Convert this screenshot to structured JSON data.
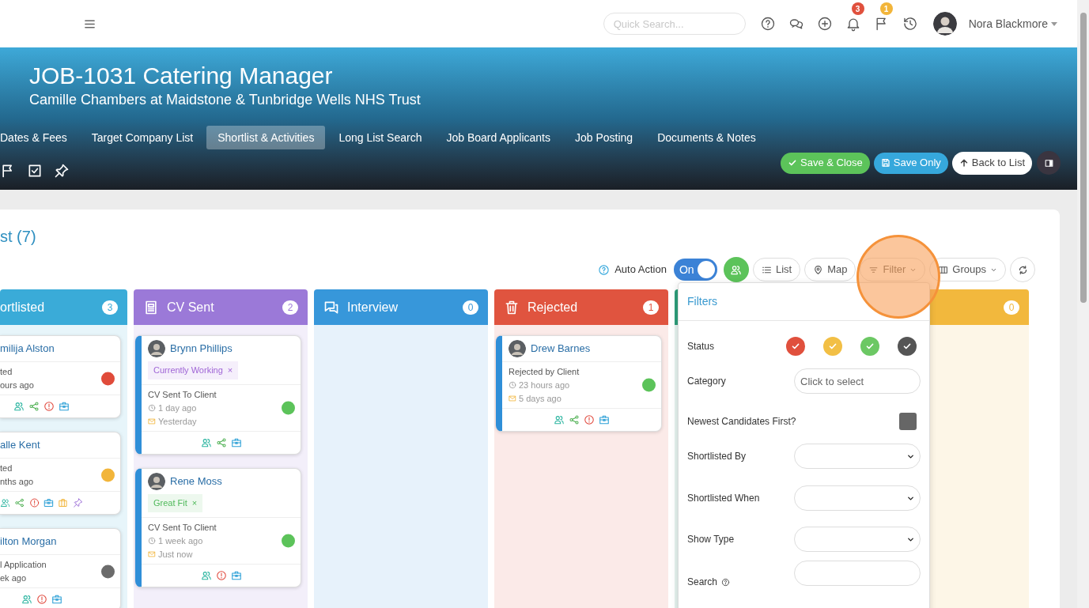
{
  "topbar": {
    "search_placeholder": "Quick Search...",
    "icons": [
      {
        "kind": "help"
      },
      {
        "kind": "chat"
      },
      {
        "kind": "add"
      },
      {
        "kind": "bell",
        "badge": "3",
        "color": "#e0503d"
      },
      {
        "kind": "flag",
        "badge": "1",
        "color": "#f2b53a"
      },
      {
        "kind": "history"
      }
    ],
    "user": {
      "name": "Nora Blackmore"
    }
  },
  "header": {
    "title": "JOB-1031 Catering Manager",
    "subtitle": "Camille Chambers at Maidstone & Tunbridge Wells NHS Trust",
    "tabs": [
      {
        "label": "Dates & Fees",
        "selected": false
      },
      {
        "label": "Target Company List",
        "selected": false
      },
      {
        "label": "Shortlist & Activities",
        "selected": true
      },
      {
        "label": "Long List Search",
        "selected": false
      },
      {
        "label": "Job Board Applicants",
        "selected": false
      },
      {
        "label": "Job Posting",
        "selected": false
      },
      {
        "label": "Documents & Notes",
        "selected": false
      }
    ],
    "quick_icons": [
      {
        "kind": "flag"
      },
      {
        "kind": "check-square"
      },
      {
        "kind": "pin"
      }
    ],
    "buttons": [
      {
        "kind": "save-close",
        "label": "Save & Close"
      },
      {
        "kind": "save",
        "label": "Save Only"
      },
      {
        "kind": "back",
        "label": "Back to List"
      },
      {
        "kind": "sidebar"
      }
    ]
  },
  "board": {
    "title": "st (7)",
    "auto_action": {
      "label": "Auto Action",
      "toggle": {
        "on": true,
        "label": "On"
      }
    },
    "tools": [
      {
        "kind": "people"
      },
      {
        "kind": "list",
        "label": "List"
      },
      {
        "kind": "map",
        "label": "Map"
      },
      {
        "kind": "filter",
        "label": "Filter"
      },
      {
        "kind": "groups",
        "label": "Groups"
      },
      {
        "kind": "refresh"
      }
    ],
    "columns": [
      {
        "kind": "plain",
        "title": "ortlisted",
        "count": "3",
        "color": "#3aabd8",
        "cards": [
          {
            "name": "milija Alston",
            "avatar": false,
            "stripe": false,
            "lines": [
              {
                "text": "ted"
              },
              {
                "text": "ours ago"
              }
            ],
            "color": "#e04b3a",
            "icons": [
              {
                "kind": "people"
              },
              {
                "kind": "share"
              },
              {
                "kind": "alert"
              },
              {
                "kind": "briefcase"
              }
            ]
          },
          {
            "name": "alle Kent",
            "avatar": false,
            "stripe": false,
            "lines": [
              {
                "text": "ted"
              },
              {
                "text": "nths ago"
              }
            ],
            "color": "#f2b53a",
            "icons": [
              {
                "kind": "people"
              },
              {
                "kind": "share"
              },
              {
                "kind": "alert"
              },
              {
                "kind": "briefcase"
              },
              {
                "kind": "suitcase"
              },
              {
                "kind": "pin"
              }
            ]
          },
          {
            "name": "ilton Morgan",
            "avatar": false,
            "stripe": false,
            "lines": [
              {
                "text": "l Application"
              },
              {
                "text": "ek ago"
              }
            ],
            "color": "#6b6b6b",
            "icons": [
              {
                "kind": "people"
              },
              {
                "kind": "alert"
              },
              {
                "kind": "briefcase"
              }
            ]
          }
        ]
      },
      {
        "kind": "cv",
        "title": "CV Sent",
        "count": "2",
        "color": "#9b79d8",
        "cards": [
          {
            "name": "Brynn Phillips",
            "avatar": true,
            "stripe": true,
            "tag": {
              "text": "Currently Working",
              "remove": "×",
              "color": "#a066d6"
            },
            "lines": [
              {
                "text": "CV Sent To Client",
                "kind": "status"
              },
              {
                "text": "1 day ago",
                "kind": "clock"
              },
              {
                "text": "Yesterday",
                "kind": "mail"
              }
            ],
            "color": "#5cc35a",
            "icons": [
              {
                "kind": "people"
              },
              {
                "kind": "share"
              },
              {
                "kind": "briefcase"
              }
            ]
          },
          {
            "name": "Rene Moss",
            "avatar": true,
            "stripe": true,
            "tag": {
              "text": "Great Fit",
              "remove": "×",
              "color": "#4fb95a"
            },
            "lines": [
              {
                "text": "CV Sent To Client",
                "kind": "status"
              },
              {
                "text": "1 week ago",
                "kind": "clock"
              },
              {
                "text": "Just now",
                "kind": "mail"
              }
            ],
            "color": "#5cc35a",
            "icons": [
              {
                "kind": "people"
              },
              {
                "kind": "alert"
              },
              {
                "kind": "briefcase"
              }
            ]
          }
        ]
      },
      {
        "kind": "interview",
        "title": "Interview",
        "count": "0",
        "color": "#3797da"
      },
      {
        "kind": "rejected",
        "title": "Rejected",
        "count": "1",
        "color": "#e0543f",
        "cards": [
          {
            "name": "Drew Barnes",
            "avatar": true,
            "stripe": true,
            "lines": [
              {
                "text": "Rejected by Client",
                "kind": "status"
              },
              {
                "text": "23 hours ago",
                "kind": "clock"
              },
              {
                "text": "5 days ago",
                "kind": "mail"
              }
            ],
            "color": "#5cc35a",
            "icons": [
              {
                "kind": "people"
              },
              {
                "kind": "share"
              },
              {
                "kind": "alert"
              },
              {
                "kind": "briefcase"
              }
            ]
          }
        ]
      },
      {
        "kind": "plain",
        "color": "#2d9e7a"
      },
      {
        "kind": "plain",
        "count": "0",
        "color": "#f2b83d"
      }
    ]
  },
  "filters": {
    "title": "Filters",
    "status": {
      "label": "Status",
      "options": [
        {
          "color": "#e0503d",
          "checked": true
        },
        {
          "color": "#f2bf45",
          "checked": true
        },
        {
          "color": "#6cc864",
          "checked": true
        },
        {
          "color": "#555555",
          "checked": true
        }
      ]
    },
    "fields": [
      {
        "kind": "tags",
        "label": "Category",
        "placeholder": "Click to select"
      },
      {
        "kind": "checkbox",
        "label": "Newest Candidates First?",
        "checked": false
      },
      {
        "kind": "select",
        "label": "Shortlisted By"
      },
      {
        "kind": "select",
        "label": "Shortlisted When"
      },
      {
        "kind": "select",
        "label": "Show Type"
      },
      {
        "kind": "search",
        "label": "Search"
      }
    ]
  },
  "pointer_highlight": true
}
